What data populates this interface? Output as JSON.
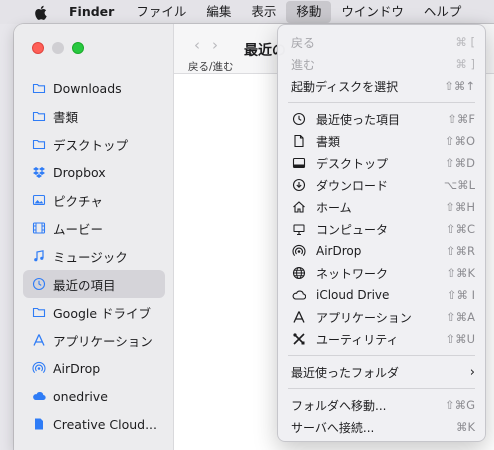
{
  "menubar": {
    "app_name": "Finder",
    "items": [
      "ファイル",
      "編集",
      "表示",
      "移動",
      "ウインドウ",
      "ヘルプ"
    ],
    "active_item": "移動"
  },
  "window": {
    "title": "最近の",
    "nav_label": "戻る/進む"
  },
  "sidebar": {
    "items": [
      {
        "label": "Downloads",
        "icon": "folder-icon"
      },
      {
        "label": "書類",
        "icon": "folder-icon"
      },
      {
        "label": "デスクトップ",
        "icon": "folder-icon"
      },
      {
        "label": "Dropbox",
        "icon": "dropbox-icon"
      },
      {
        "label": "ピクチャ",
        "icon": "photo-icon"
      },
      {
        "label": "ムービー",
        "icon": "film-icon"
      },
      {
        "label": "ミュージック",
        "icon": "music-icon"
      },
      {
        "label": "最近の項目",
        "icon": "clock-icon",
        "selected": true
      },
      {
        "label": "Google ドライブ",
        "icon": "folder-icon"
      },
      {
        "label": "アプリケーション",
        "icon": "apps-icon"
      },
      {
        "label": "AirDrop",
        "icon": "airdrop-icon"
      },
      {
        "label": "onedrive",
        "icon": "cloud-icon"
      },
      {
        "label": "Creative Cloud...",
        "icon": "document-icon"
      }
    ]
  },
  "go_menu": {
    "back": {
      "label": "戻る",
      "shortcut": "⌘ ["
    },
    "forward": {
      "label": "進む",
      "shortcut": "⌘ ]"
    },
    "startup": {
      "label": "起動ディスクを選択",
      "shortcut": "⇧⌘↑"
    },
    "places": [
      {
        "label": "最近使った項目",
        "shortcut": "⇧⌘F",
        "icon": "clock-icon"
      },
      {
        "label": "書類",
        "shortcut": "⇧⌘O",
        "icon": "document-icon"
      },
      {
        "label": "デスクトップ",
        "shortcut": "⇧⌘D",
        "icon": "desktop-icon"
      },
      {
        "label": "ダウンロード",
        "shortcut": "⌥⌘L",
        "icon": "download-icon"
      },
      {
        "label": "ホーム",
        "shortcut": "⇧⌘H",
        "icon": "home-icon"
      },
      {
        "label": "コンピュータ",
        "shortcut": "⇧⌘C",
        "icon": "computer-icon"
      },
      {
        "label": "AirDrop",
        "shortcut": "⇧⌘R",
        "icon": "airdrop-icon"
      },
      {
        "label": "ネットワーク",
        "shortcut": "⇧⌘K",
        "icon": "globe-icon"
      },
      {
        "label": "iCloud Drive",
        "shortcut": "⇧⌘ I",
        "icon": "cloud-icon"
      },
      {
        "label": "アプリケーション",
        "shortcut": "⇧⌘A",
        "icon": "apps-icon"
      },
      {
        "label": "ユーティリティ",
        "shortcut": "⇧⌘U",
        "icon": "tools-icon"
      }
    ],
    "recent_folders": {
      "label": "最近使ったフォルダ"
    },
    "goto_folder": {
      "label": "フォルダへ移動...",
      "shortcut": "⇧⌘G"
    },
    "connect_server": {
      "label": "サーバへ接続...",
      "shortcut": "⌘K"
    }
  },
  "colors": {
    "sidebar_icon": "#2f7cf6",
    "close": "#fe5f57",
    "maximize": "#28c840"
  }
}
